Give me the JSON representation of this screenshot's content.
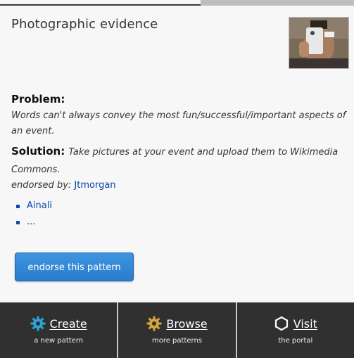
{
  "pattern": {
    "title": "Photographic evidence",
    "problem_label": "Problem:",
    "problem_text": "Words can't always convey the most fun/successful/important aspects of an event.",
    "solution_label": "Solution:",
    "solution_text": "Take pictures at your event and upload them to Wikimedia Commons.",
    "endorsed_by_label": "endorsed by:",
    "endorsed_by_user": "Jtmorgan",
    "endorsers": [
      "Ainali",
      "..."
    ],
    "endorse_button": "endorse this pattern"
  },
  "footer": {
    "items": [
      {
        "label": "Create",
        "sub": "a new pattern",
        "icon": "gear-icon",
        "color": "#2aa3d8"
      },
      {
        "label": "Browse",
        "sub": "more patterns",
        "icon": "gear-icon",
        "color": "#d9a43a"
      },
      {
        "label": "Visit",
        "sub": "the portal",
        "icon": "hexagon-icon",
        "color": "#ffffff"
      }
    ]
  },
  "colors": {
    "link": "#0645ad",
    "button": "#2a7ccc",
    "footer_bg": "#303030"
  }
}
